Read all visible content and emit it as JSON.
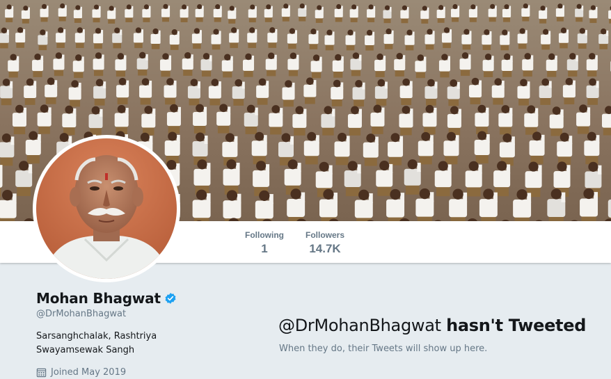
{
  "banner": {
    "description_icon": "header-photo"
  },
  "stats": {
    "following_label": "Following",
    "following_value": "1",
    "followers_label": "Followers",
    "followers_value": "14.7K"
  },
  "profile": {
    "name": "Mohan Bhagwat",
    "verified": true,
    "handle": "@DrMohanBhagwat",
    "bio": "Sarsanghchalak, Rashtriya Swayamsewak Sangh",
    "joined": "Joined May 2019"
  },
  "timeline": {
    "empty_handle": "@DrMohanBhagwat",
    "empty_title_rest": "hasn't Tweeted",
    "empty_subtitle": "When they do, their Tweets will show up here."
  },
  "colors": {
    "verified_blue": "#1da1f2",
    "secondary_text": "#657786",
    "page_bg": "#e6ecf0"
  }
}
